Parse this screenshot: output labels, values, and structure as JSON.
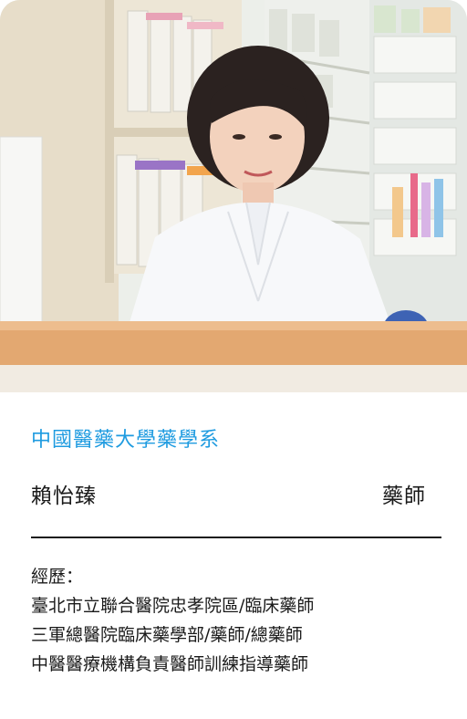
{
  "profile": {
    "school": "中國醫藥大學藥學系",
    "name": "賴怡臻",
    "title": "藥師",
    "experience_heading": "經歷：",
    "experience": [
      "臺北市立聯合醫院忠孝院區/臨床藥師",
      "三軍總醫院臨床藥學部/藥師/總藥師",
      "中醫醫療機構負責醫師訓練指導藥師"
    ]
  },
  "colors": {
    "accent": "#1e9be0",
    "text": "#1a1a1a",
    "rule": "#1a1a1a"
  }
}
